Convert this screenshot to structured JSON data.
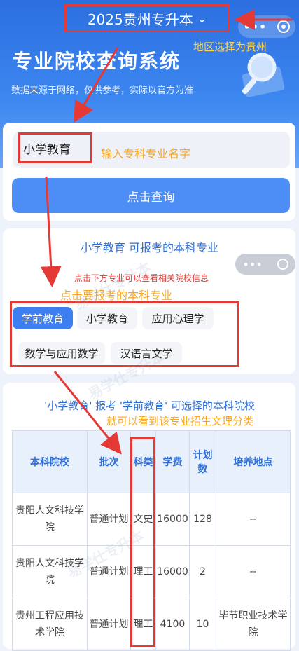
{
  "header": {
    "region_label": "2025贵州专升本",
    "annotation_region": "地区选择为贵州",
    "system_title": "专业院校查询系统",
    "subtitle": "数据来源于网络，仅供参考，实际以官方为准"
  },
  "search": {
    "input_value": "小学教育",
    "annotation": "输入专科专业名字",
    "button_label": "点击查询"
  },
  "majors": {
    "title": "小学教育 可报考的本科专业",
    "tip": "点击下方专业可以查看相关院校信息",
    "annotation": "点击要报考的本科专业",
    "tags": [
      "学前教育",
      "小学教育",
      "应用心理学",
      "数学与应用数学",
      "汉语言文学"
    ]
  },
  "results": {
    "title": "'小学教育' 报考 '学前教育' 可选择的本科院校",
    "annotation": "就可以看到该专业招生文理分类",
    "headers": [
      "本科院校",
      "批次",
      "科类",
      "学费",
      "计划数",
      "培养地点"
    ],
    "rows": [
      [
        "贵阳人文科技学院",
        "普通计划",
        "文史",
        "16000",
        "128",
        "--"
      ],
      [
        "贵阳人文科技学院",
        "普通计划",
        "理工",
        "16000",
        "2",
        "--"
      ],
      [
        "贵州工程应用技术学院",
        "普通计划",
        "理工",
        "4100",
        "10",
        "毕节职业技术学院"
      ]
    ]
  },
  "watermark": "易学仕专升本",
  "colors": {
    "primary": "#3d7ef0",
    "annotation_red": "#e53935",
    "annotation_orange": "#f5a623"
  }
}
